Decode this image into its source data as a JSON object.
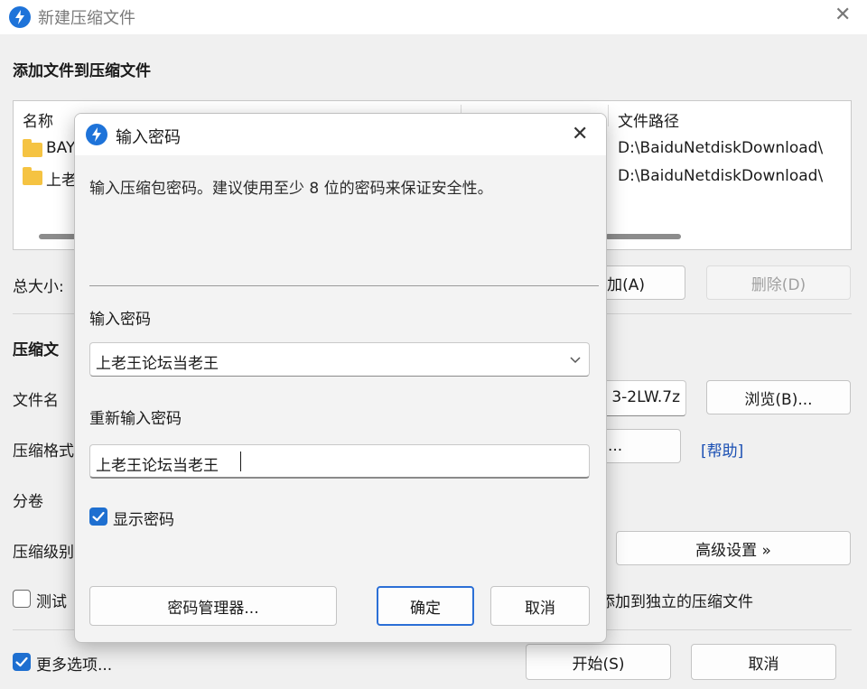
{
  "window": {
    "title": "新建压缩文件",
    "close_glyph": "✕",
    "section_title": "添加文件到压缩文件",
    "file_list": {
      "columns": [
        "名称",
        "文件路径"
      ],
      "rows": [
        {
          "name": "BAY",
          "path": "D:\\BaiduNetdiskDownload\\"
        },
        {
          "name": "上老",
          "path": "D:\\BaiduNetdiskDownload\\"
        }
      ]
    },
    "total_size_label": "总大小:",
    "add_button": "加(A)",
    "delete_button": "删除(D)",
    "compress_section_label": "压缩文",
    "filename_label": "文件名",
    "filename_value_tail": "3-2LW.7z",
    "browse_button": "浏览(B)...",
    "format_label": "压缩格式",
    "format_button_tail": "...",
    "help_link": "[帮助]",
    "split_label": "分卷",
    "level_label": "压缩级别",
    "advanced_button": "高级设置 »",
    "test_checkbox_label": "测试",
    "independent_label": "添加到独立的压缩文件",
    "more_options_label": "更多选项...",
    "start_button": "开始(S)",
    "cancel_button": "取消"
  },
  "dialog": {
    "title": "输入密码",
    "close_glyph": "✕",
    "instruction": "输入压缩包密码。建议使用至少 8 位的密码来保证安全性。",
    "password_label": "输入密码",
    "password_value": "上老王论坛当老王",
    "reenter_label": "重新输入密码",
    "reenter_value": "上老王论坛当老王",
    "show_password_label": "显示密码",
    "show_password_checked": true,
    "manager_button": "密码管理器...",
    "ok_button": "确定",
    "cancel_button": "取消"
  },
  "colors": {
    "accent": "#1e6fd0",
    "link": "#1a4fb3"
  }
}
